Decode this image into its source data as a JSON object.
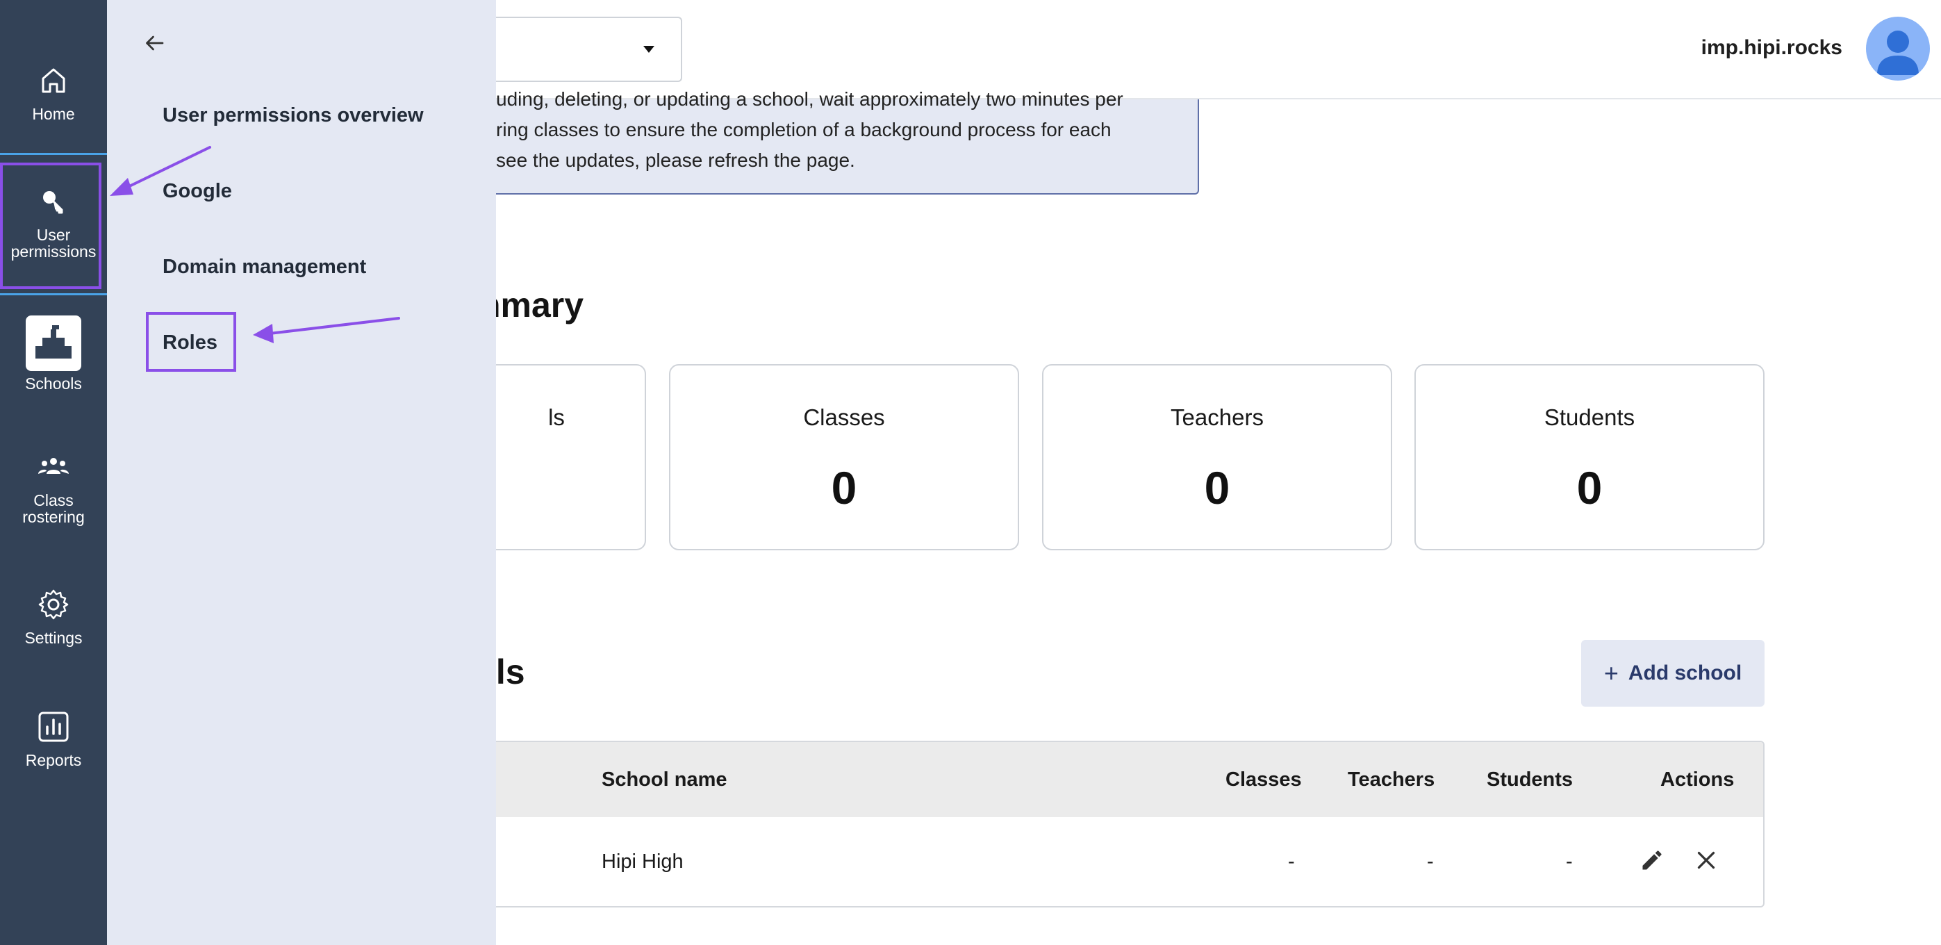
{
  "nav": {
    "items": [
      {
        "id": "home",
        "label": "Home",
        "icon": "home-icon"
      },
      {
        "id": "user-permissions",
        "label_line1": "User",
        "label_line2": "permissions",
        "icon": "key-icon"
      },
      {
        "id": "schools",
        "label": "Schools",
        "icon": "school-building-icon"
      },
      {
        "id": "class-rostering",
        "label_line1": "Class",
        "label_line2": "rostering",
        "icon": "people-group-icon"
      },
      {
        "id": "settings",
        "label": "Settings",
        "icon": "gear-icon"
      },
      {
        "id": "reports",
        "label": "Reports",
        "icon": "bar-chart-icon"
      }
    ]
  },
  "flyout": {
    "items": [
      {
        "label": "User permissions overview"
      },
      {
        "label": "Google"
      },
      {
        "label": "Domain management"
      },
      {
        "label": "Roles"
      }
    ]
  },
  "header": {
    "domain": "imp.hipi.rocks"
  },
  "notice": {
    "line1": "uding, deleting, or updating a school, wait approximately two minutes per",
    "line2": "ring classes to ensure the completion of a background process for each",
    "line3": "see the updates, please refresh the page."
  },
  "summary": {
    "title_fragment": "nmary",
    "cards": [
      {
        "label": "ls",
        "value": ""
      },
      {
        "label": "Classes",
        "value": "0"
      },
      {
        "label": "Teachers",
        "value": "0"
      },
      {
        "label": "Students",
        "value": "0"
      }
    ]
  },
  "details": {
    "title_fragment": "ils",
    "add_button": {
      "icon": "plus-icon",
      "label": "Add school"
    },
    "table": {
      "headers": {
        "school_name": "School name",
        "classes": "Classes",
        "teachers": "Teachers",
        "students": "Students",
        "actions": "Actions"
      },
      "rows": [
        {
          "school_name": "Hipi High",
          "classes": "-",
          "teachers": "-",
          "students": "-"
        }
      ]
    }
  },
  "colors": {
    "rail": "#334257",
    "flyout": "#e4e8f3",
    "annotation": "#8a4fe8"
  }
}
